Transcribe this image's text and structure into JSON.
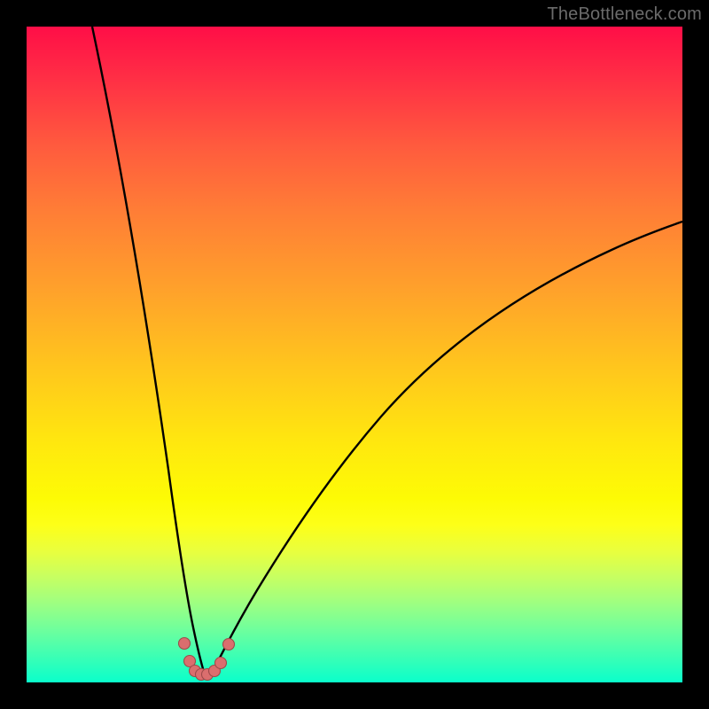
{
  "watermark": "TheBottleneck.com",
  "colors": {
    "frame": "#000000",
    "curve": "#000000",
    "dots_fill": "#da6e6e",
    "dots_stroke": "#9d4a4a",
    "gradient_stops": [
      "#ff0e47",
      "#ff2f45",
      "#ff5a3e",
      "#ff7d36",
      "#ffa12b",
      "#ffc61d",
      "#ffe90e",
      "#fdfb05",
      "#fdff18",
      "#e9ff3e",
      "#c6ff62",
      "#9dff82",
      "#6eff9d",
      "#3cffb4",
      "#0affcb"
    ]
  },
  "chart_data": {
    "type": "line",
    "title": "",
    "xlabel": "",
    "ylabel": "",
    "xlim": [
      0,
      100
    ],
    "ylim": [
      0,
      100
    ],
    "note": "V-shaped bottleneck curve. Vertex near x≈27, y≈1. Left branch rises to y≈100 at x≈10; right branch rises to y≈64 at x≈100. Values estimated from pixels; no axis ticks or numeric labels are shown in the image.",
    "series": [
      {
        "name": "bottleneck-curve",
        "x": [
          10,
          12,
          14,
          16,
          18,
          20,
          22,
          24,
          25,
          26,
          27,
          28,
          29,
          30,
          32,
          35,
          40,
          45,
          50,
          55,
          60,
          65,
          70,
          75,
          80,
          85,
          90,
          95,
          100
        ],
        "y": [
          100,
          86,
          72,
          59,
          46,
          34,
          23,
          12,
          8,
          4,
          1,
          1,
          2,
          4,
          8,
          13,
          20,
          26,
          32,
          37,
          42,
          46,
          50,
          53,
          56,
          59,
          61,
          63,
          64
        ]
      }
    ],
    "marker_points": {
      "name": "vertex-marker-dots",
      "x": [
        24.0,
        24.8,
        25.7,
        26.6,
        27.6,
        28.6,
        29.6,
        30.8
      ],
      "y": [
        6.0,
        3.3,
        1.8,
        1.2,
        1.2,
        1.8,
        3.0,
        5.8
      ]
    }
  }
}
